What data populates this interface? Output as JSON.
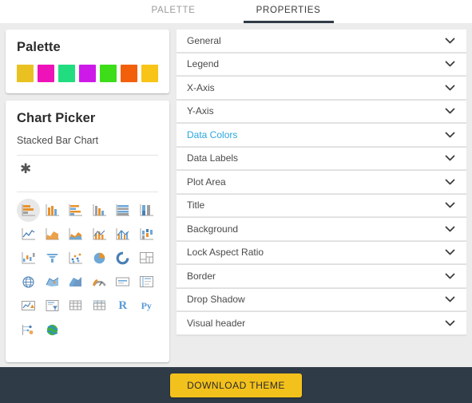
{
  "tabs": [
    {
      "label": "PALETTE",
      "active": false
    },
    {
      "label": "PROPERTIES",
      "active": true
    }
  ],
  "palette": {
    "title": "Palette",
    "colors": [
      "#e9c221",
      "#ee13b8",
      "#22dd7f",
      "#ce1ae8",
      "#3ddd1a",
      "#f2600c",
      "#f8c417"
    ]
  },
  "chart_picker": {
    "title": "Chart Picker",
    "selected_chart": "Stacked Bar Chart",
    "custom_marker": "✱",
    "icons": [
      "stacked-bar-chart-icon",
      "clustered-column-chart-icon",
      "clustered-bar-chart-icon",
      "stacked-column-chart-icon",
      "hundred-percent-stacked-bar-chart-icon",
      "hundred-percent-stacked-column-chart-icon",
      "line-chart-icon",
      "area-chart-icon",
      "stacked-area-chart-icon",
      "line-stacked-column-chart-icon",
      "line-clustered-column-chart-icon",
      "ribbon-chart-icon",
      "waterfall-chart-icon",
      "funnel-chart-icon",
      "scatter-chart-icon",
      "pie-chart-icon",
      "donut-chart-icon",
      "treemap-icon",
      "map-icon",
      "filled-map-icon",
      "shape-map-icon",
      "gauge-icon",
      "card-icon",
      "multi-row-card-icon",
      "kpi-icon",
      "slicer-icon",
      "table-icon",
      "matrix-icon",
      "r-script-visual-icon",
      "python-visual-icon",
      "key-influencers-icon",
      "arcgis-map-icon"
    ]
  },
  "properties": {
    "items": [
      {
        "label": "General",
        "active": false
      },
      {
        "label": "Legend",
        "active": false
      },
      {
        "label": "X-Axis",
        "active": false
      },
      {
        "label": "Y-Axis",
        "active": false
      },
      {
        "label": "Data Colors",
        "active": true
      },
      {
        "label": "Data Labels",
        "active": false
      },
      {
        "label": "Plot Area",
        "active": false
      },
      {
        "label": "Title",
        "active": false
      },
      {
        "label": "Background",
        "active": false
      },
      {
        "label": "Lock Aspect Ratio",
        "active": false
      },
      {
        "label": "Border",
        "active": false
      },
      {
        "label": "Drop Shadow",
        "active": false
      },
      {
        "label": "Visual header",
        "active": false
      }
    ],
    "accent_color": "#2ba6dd",
    "chevron_icon": "chevron-down-icon"
  },
  "footer": {
    "download_label": "DOWNLOAD THEME",
    "button_color": "#f3c11c",
    "bar_color": "#2f3b47"
  }
}
